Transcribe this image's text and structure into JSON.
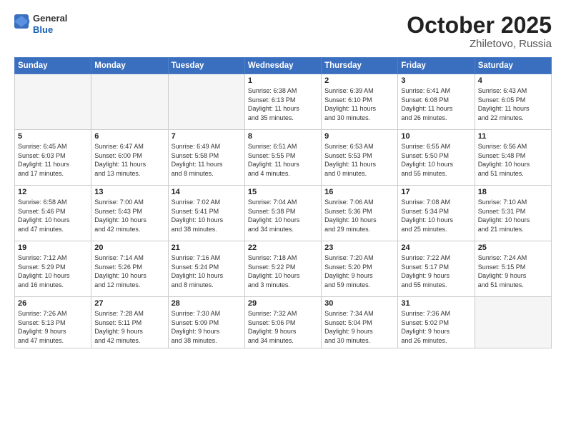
{
  "header": {
    "logo_general": "General",
    "logo_blue": "Blue",
    "month_title": "October 2025",
    "location": "Zhiletovo, Russia"
  },
  "weekdays": [
    "Sunday",
    "Monday",
    "Tuesday",
    "Wednesday",
    "Thursday",
    "Friday",
    "Saturday"
  ],
  "weeks": [
    [
      {
        "day": "",
        "info": ""
      },
      {
        "day": "",
        "info": ""
      },
      {
        "day": "",
        "info": ""
      },
      {
        "day": "1",
        "info": "Sunrise: 6:38 AM\nSunset: 6:13 PM\nDaylight: 11 hours\nand 35 minutes."
      },
      {
        "day": "2",
        "info": "Sunrise: 6:39 AM\nSunset: 6:10 PM\nDaylight: 11 hours\nand 30 minutes."
      },
      {
        "day": "3",
        "info": "Sunrise: 6:41 AM\nSunset: 6:08 PM\nDaylight: 11 hours\nand 26 minutes."
      },
      {
        "day": "4",
        "info": "Sunrise: 6:43 AM\nSunset: 6:05 PM\nDaylight: 11 hours\nand 22 minutes."
      }
    ],
    [
      {
        "day": "5",
        "info": "Sunrise: 6:45 AM\nSunset: 6:03 PM\nDaylight: 11 hours\nand 17 minutes."
      },
      {
        "day": "6",
        "info": "Sunrise: 6:47 AM\nSunset: 6:00 PM\nDaylight: 11 hours\nand 13 minutes."
      },
      {
        "day": "7",
        "info": "Sunrise: 6:49 AM\nSunset: 5:58 PM\nDaylight: 11 hours\nand 8 minutes."
      },
      {
        "day": "8",
        "info": "Sunrise: 6:51 AM\nSunset: 5:55 PM\nDaylight: 11 hours\nand 4 minutes."
      },
      {
        "day": "9",
        "info": "Sunrise: 6:53 AM\nSunset: 5:53 PM\nDaylight: 11 hours\nand 0 minutes."
      },
      {
        "day": "10",
        "info": "Sunrise: 6:55 AM\nSunset: 5:50 PM\nDaylight: 10 hours\nand 55 minutes."
      },
      {
        "day": "11",
        "info": "Sunrise: 6:56 AM\nSunset: 5:48 PM\nDaylight: 10 hours\nand 51 minutes."
      }
    ],
    [
      {
        "day": "12",
        "info": "Sunrise: 6:58 AM\nSunset: 5:46 PM\nDaylight: 10 hours\nand 47 minutes."
      },
      {
        "day": "13",
        "info": "Sunrise: 7:00 AM\nSunset: 5:43 PM\nDaylight: 10 hours\nand 42 minutes."
      },
      {
        "day": "14",
        "info": "Sunrise: 7:02 AM\nSunset: 5:41 PM\nDaylight: 10 hours\nand 38 minutes."
      },
      {
        "day": "15",
        "info": "Sunrise: 7:04 AM\nSunset: 5:38 PM\nDaylight: 10 hours\nand 34 minutes."
      },
      {
        "day": "16",
        "info": "Sunrise: 7:06 AM\nSunset: 5:36 PM\nDaylight: 10 hours\nand 29 minutes."
      },
      {
        "day": "17",
        "info": "Sunrise: 7:08 AM\nSunset: 5:34 PM\nDaylight: 10 hours\nand 25 minutes."
      },
      {
        "day": "18",
        "info": "Sunrise: 7:10 AM\nSunset: 5:31 PM\nDaylight: 10 hours\nand 21 minutes."
      }
    ],
    [
      {
        "day": "19",
        "info": "Sunrise: 7:12 AM\nSunset: 5:29 PM\nDaylight: 10 hours\nand 16 minutes."
      },
      {
        "day": "20",
        "info": "Sunrise: 7:14 AM\nSunset: 5:26 PM\nDaylight: 10 hours\nand 12 minutes."
      },
      {
        "day": "21",
        "info": "Sunrise: 7:16 AM\nSunset: 5:24 PM\nDaylight: 10 hours\nand 8 minutes."
      },
      {
        "day": "22",
        "info": "Sunrise: 7:18 AM\nSunset: 5:22 PM\nDaylight: 10 hours\nand 3 minutes."
      },
      {
        "day": "23",
        "info": "Sunrise: 7:20 AM\nSunset: 5:20 PM\nDaylight: 9 hours\nand 59 minutes."
      },
      {
        "day": "24",
        "info": "Sunrise: 7:22 AM\nSunset: 5:17 PM\nDaylight: 9 hours\nand 55 minutes."
      },
      {
        "day": "25",
        "info": "Sunrise: 7:24 AM\nSunset: 5:15 PM\nDaylight: 9 hours\nand 51 minutes."
      }
    ],
    [
      {
        "day": "26",
        "info": "Sunrise: 7:26 AM\nSunset: 5:13 PM\nDaylight: 9 hours\nand 47 minutes."
      },
      {
        "day": "27",
        "info": "Sunrise: 7:28 AM\nSunset: 5:11 PM\nDaylight: 9 hours\nand 42 minutes."
      },
      {
        "day": "28",
        "info": "Sunrise: 7:30 AM\nSunset: 5:09 PM\nDaylight: 9 hours\nand 38 minutes."
      },
      {
        "day": "29",
        "info": "Sunrise: 7:32 AM\nSunset: 5:06 PM\nDaylight: 9 hours\nand 34 minutes."
      },
      {
        "day": "30",
        "info": "Sunrise: 7:34 AM\nSunset: 5:04 PM\nDaylight: 9 hours\nand 30 minutes."
      },
      {
        "day": "31",
        "info": "Sunrise: 7:36 AM\nSunset: 5:02 PM\nDaylight: 9 hours\nand 26 minutes."
      },
      {
        "day": "",
        "info": ""
      }
    ]
  ]
}
